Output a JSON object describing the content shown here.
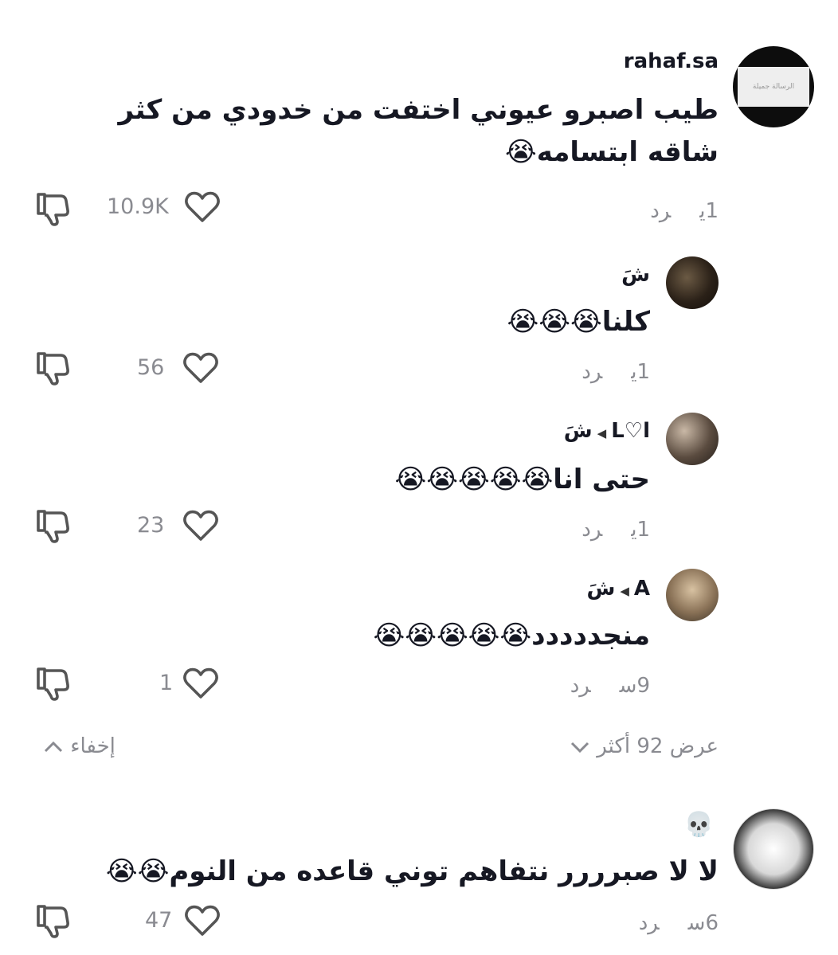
{
  "comments": [
    {
      "username": "rahaf.sa",
      "text": "طيب اصبرو عيوني اختفت من خدودي من كثر شاقه ابتسامه",
      "emoji": "😭",
      "time": "1ي",
      "reply_label": "رد",
      "likes": "10.9K",
      "avatar_text": "الرسالة جميلة"
    },
    {
      "username": "شَ",
      "text": "كلنا",
      "emoji": "😭😭😭",
      "time": "1ي",
      "reply_label": "رد",
      "likes": "56"
    },
    {
      "username": "L♡l",
      "reply_to": "شَ",
      "text": "حتى انا",
      "emoji": "😭😭😭😭😭",
      "time": "1ي",
      "reply_label": "رد",
      "likes": "23"
    },
    {
      "username": "A",
      "reply_to": "شَ",
      "text": "منجددددد",
      "emoji": "😭😭😭😭😭",
      "time": "9س",
      "reply_label": "رد",
      "likes": "1"
    },
    {
      "username": "💀",
      "text": "لا لا صبرررر نتفاهم توني قاعده من النوم",
      "emoji": "😭😭",
      "time": "6س",
      "reply_label": "رد",
      "likes": "47"
    }
  ],
  "thread": {
    "view_more": "عرض 92 أكثر",
    "hide": "إخفاء"
  },
  "colors": {
    "text": "#161823",
    "muted": "#8a8b91",
    "background": "#ffffff"
  }
}
